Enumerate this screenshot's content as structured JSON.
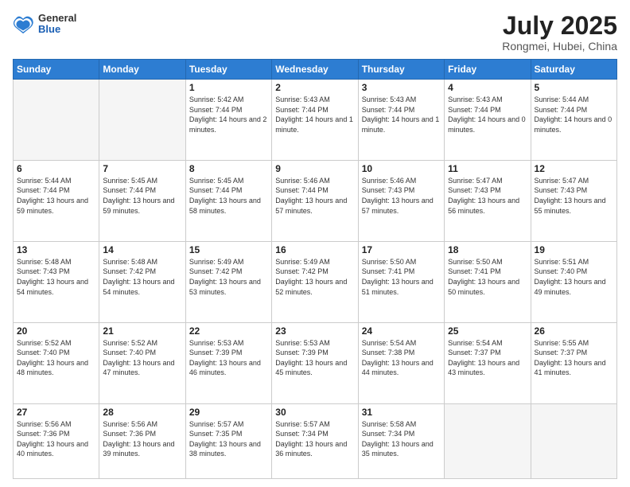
{
  "header": {
    "logo": {
      "general": "General",
      "blue": "Blue"
    },
    "month": "July 2025",
    "location": "Rongmei, Hubei, China"
  },
  "days_of_week": [
    "Sunday",
    "Monday",
    "Tuesday",
    "Wednesday",
    "Thursday",
    "Friday",
    "Saturday"
  ],
  "weeks": [
    [
      {
        "day": "",
        "empty": true
      },
      {
        "day": "",
        "empty": true
      },
      {
        "day": "1",
        "sunrise": "Sunrise: 5:42 AM",
        "sunset": "Sunset: 7:44 PM",
        "daylight": "Daylight: 14 hours and 2 minutes."
      },
      {
        "day": "2",
        "sunrise": "Sunrise: 5:43 AM",
        "sunset": "Sunset: 7:44 PM",
        "daylight": "Daylight: 14 hours and 1 minute."
      },
      {
        "day": "3",
        "sunrise": "Sunrise: 5:43 AM",
        "sunset": "Sunset: 7:44 PM",
        "daylight": "Daylight: 14 hours and 1 minute."
      },
      {
        "day": "4",
        "sunrise": "Sunrise: 5:43 AM",
        "sunset": "Sunset: 7:44 PM",
        "daylight": "Daylight: 14 hours and 0 minutes."
      },
      {
        "day": "5",
        "sunrise": "Sunrise: 5:44 AM",
        "sunset": "Sunset: 7:44 PM",
        "daylight": "Daylight: 14 hours and 0 minutes."
      }
    ],
    [
      {
        "day": "6",
        "sunrise": "Sunrise: 5:44 AM",
        "sunset": "Sunset: 7:44 PM",
        "daylight": "Daylight: 13 hours and 59 minutes."
      },
      {
        "day": "7",
        "sunrise": "Sunrise: 5:45 AM",
        "sunset": "Sunset: 7:44 PM",
        "daylight": "Daylight: 13 hours and 59 minutes."
      },
      {
        "day": "8",
        "sunrise": "Sunrise: 5:45 AM",
        "sunset": "Sunset: 7:44 PM",
        "daylight": "Daylight: 13 hours and 58 minutes."
      },
      {
        "day": "9",
        "sunrise": "Sunrise: 5:46 AM",
        "sunset": "Sunset: 7:44 PM",
        "daylight": "Daylight: 13 hours and 57 minutes."
      },
      {
        "day": "10",
        "sunrise": "Sunrise: 5:46 AM",
        "sunset": "Sunset: 7:43 PM",
        "daylight": "Daylight: 13 hours and 57 minutes."
      },
      {
        "day": "11",
        "sunrise": "Sunrise: 5:47 AM",
        "sunset": "Sunset: 7:43 PM",
        "daylight": "Daylight: 13 hours and 56 minutes."
      },
      {
        "day": "12",
        "sunrise": "Sunrise: 5:47 AM",
        "sunset": "Sunset: 7:43 PM",
        "daylight": "Daylight: 13 hours and 55 minutes."
      }
    ],
    [
      {
        "day": "13",
        "sunrise": "Sunrise: 5:48 AM",
        "sunset": "Sunset: 7:43 PM",
        "daylight": "Daylight: 13 hours and 54 minutes."
      },
      {
        "day": "14",
        "sunrise": "Sunrise: 5:48 AM",
        "sunset": "Sunset: 7:42 PM",
        "daylight": "Daylight: 13 hours and 54 minutes."
      },
      {
        "day": "15",
        "sunrise": "Sunrise: 5:49 AM",
        "sunset": "Sunset: 7:42 PM",
        "daylight": "Daylight: 13 hours and 53 minutes."
      },
      {
        "day": "16",
        "sunrise": "Sunrise: 5:49 AM",
        "sunset": "Sunset: 7:42 PM",
        "daylight": "Daylight: 13 hours and 52 minutes."
      },
      {
        "day": "17",
        "sunrise": "Sunrise: 5:50 AM",
        "sunset": "Sunset: 7:41 PM",
        "daylight": "Daylight: 13 hours and 51 minutes."
      },
      {
        "day": "18",
        "sunrise": "Sunrise: 5:50 AM",
        "sunset": "Sunset: 7:41 PM",
        "daylight": "Daylight: 13 hours and 50 minutes."
      },
      {
        "day": "19",
        "sunrise": "Sunrise: 5:51 AM",
        "sunset": "Sunset: 7:40 PM",
        "daylight": "Daylight: 13 hours and 49 minutes."
      }
    ],
    [
      {
        "day": "20",
        "sunrise": "Sunrise: 5:52 AM",
        "sunset": "Sunset: 7:40 PM",
        "daylight": "Daylight: 13 hours and 48 minutes."
      },
      {
        "day": "21",
        "sunrise": "Sunrise: 5:52 AM",
        "sunset": "Sunset: 7:40 PM",
        "daylight": "Daylight: 13 hours and 47 minutes."
      },
      {
        "day": "22",
        "sunrise": "Sunrise: 5:53 AM",
        "sunset": "Sunset: 7:39 PM",
        "daylight": "Daylight: 13 hours and 46 minutes."
      },
      {
        "day": "23",
        "sunrise": "Sunrise: 5:53 AM",
        "sunset": "Sunset: 7:39 PM",
        "daylight": "Daylight: 13 hours and 45 minutes."
      },
      {
        "day": "24",
        "sunrise": "Sunrise: 5:54 AM",
        "sunset": "Sunset: 7:38 PM",
        "daylight": "Daylight: 13 hours and 44 minutes."
      },
      {
        "day": "25",
        "sunrise": "Sunrise: 5:54 AM",
        "sunset": "Sunset: 7:37 PM",
        "daylight": "Daylight: 13 hours and 43 minutes."
      },
      {
        "day": "26",
        "sunrise": "Sunrise: 5:55 AM",
        "sunset": "Sunset: 7:37 PM",
        "daylight": "Daylight: 13 hours and 41 minutes."
      }
    ],
    [
      {
        "day": "27",
        "sunrise": "Sunrise: 5:56 AM",
        "sunset": "Sunset: 7:36 PM",
        "daylight": "Daylight: 13 hours and 40 minutes."
      },
      {
        "day": "28",
        "sunrise": "Sunrise: 5:56 AM",
        "sunset": "Sunset: 7:36 PM",
        "daylight": "Daylight: 13 hours and 39 minutes."
      },
      {
        "day": "29",
        "sunrise": "Sunrise: 5:57 AM",
        "sunset": "Sunset: 7:35 PM",
        "daylight": "Daylight: 13 hours and 38 minutes."
      },
      {
        "day": "30",
        "sunrise": "Sunrise: 5:57 AM",
        "sunset": "Sunset: 7:34 PM",
        "daylight": "Daylight: 13 hours and 36 minutes."
      },
      {
        "day": "31",
        "sunrise": "Sunrise: 5:58 AM",
        "sunset": "Sunset: 7:34 PM",
        "daylight": "Daylight: 13 hours and 35 minutes."
      },
      {
        "day": "",
        "empty": true
      },
      {
        "day": "",
        "empty": true
      }
    ]
  ]
}
